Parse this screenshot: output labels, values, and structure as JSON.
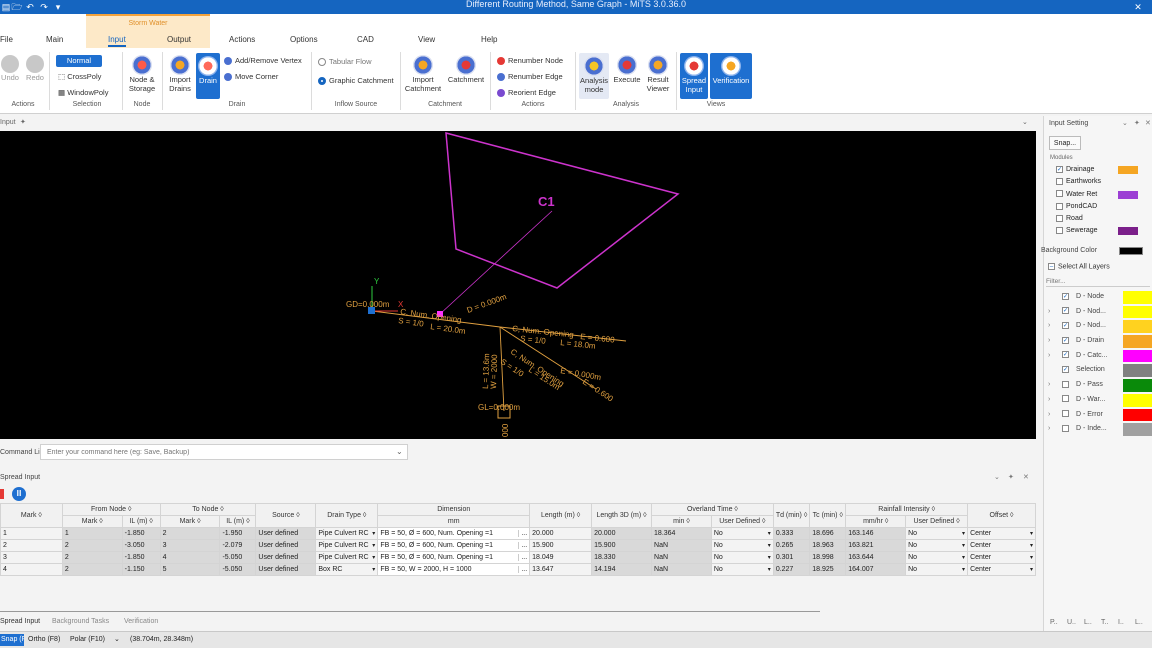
{
  "window": {
    "title": "Different Routing Method, Same Graph - MiTS 3.0.36.0"
  },
  "tabs": [
    {
      "label": "File"
    },
    {
      "label": "Main"
    },
    {
      "label": "Input"
    },
    {
      "label": "Output"
    },
    {
      "label": "Actions"
    },
    {
      "label": "Options"
    },
    {
      "label": "CAD"
    },
    {
      "label": "View"
    },
    {
      "label": "Help"
    }
  ],
  "context_tab_group": "Storm Water",
  "ribbon": {
    "actions": {
      "undo": "Undo",
      "redo": "Redo",
      "group": "Actions"
    },
    "selection": {
      "normal": "Normal",
      "crosspoly": "CrossPoly",
      "windowpoly": "WindowPoly",
      "group": "Selection"
    },
    "node": {
      "node_storage_1": "Node &",
      "node_storage_2": "Storage",
      "group": "Node"
    },
    "drain": {
      "import_1": "Import",
      "import_2": "Drains",
      "drain": "Drain",
      "add_remove_vertex": "Add/Remove Vertex",
      "move_corner": "Move Corner",
      "group": "Drain"
    },
    "inflow": {
      "tabular_flow": "Tabular Flow",
      "graphic_catchment": "Graphic Catchment",
      "group": "Inflow Source"
    },
    "catchment": {
      "import_1": "Import",
      "import_2": "Catchment",
      "catchment": "Catchment",
      "group": "Catchment"
    },
    "actions2": {
      "renumber_node": "Renumber Node",
      "renumber_edge": "Renumber Edge",
      "reorient_edge": "Reorient Edge",
      "group": "Actions"
    },
    "analysis": {
      "analysis_1": "Analysis",
      "analysis_2": "mode",
      "execute": "Execute",
      "result_1": "Result",
      "result_2": "Viewer",
      "group": "Analysis"
    },
    "views": {
      "spread_1": "Spread",
      "spread_2": "Input",
      "verification": "Verification",
      "group": "Views"
    }
  },
  "input_panel": {
    "title": "Input"
  },
  "canvas": {
    "catchment_label": "C1",
    "labels": [
      "GD=0.000m",
      "X",
      "Y",
      "C, Num. Opening",
      "S = 1/0",
      "L = 20.0m",
      "D = 0.000m",
      "C, Num. Opening",
      "E = 0.600",
      "S = 1/0",
      "L = 18.0m",
      "C, Num. Opening",
      "S = 1/0",
      "L = 15.0m",
      "E = 0.000m",
      "E = 0.600",
      "W = 2000",
      "L = 13.6m",
      "GL=0.000m",
      "000"
    ]
  },
  "command_line": {
    "label": "Command Line",
    "placeholder": "Enter your command here (eg: Save, Backup)"
  },
  "spread_input": {
    "title": "Spread Input",
    "group_headers": {
      "from_node": "From Node",
      "to_node": "To Node",
      "dimension": "Dimension",
      "overland_time": "Overland Time",
      "rainfall_intensity": "Rainfall Intensity"
    },
    "columns": {
      "mark": "Mark",
      "from_mark": "Mark",
      "from_il": "IL (m)",
      "to_mark": "Mark",
      "to_il": "IL (m)",
      "source": "Source",
      "drain_type": "Drain Type",
      "dimension_unit": "mm",
      "length": "Length (m)",
      "length3d": "Length 3D (m)",
      "ot_min": "min",
      "ot_user": "User Defined",
      "td": "Td (min)",
      "tc": "Tc (min)",
      "ri_unit": "mm/hr",
      "ri_user": "User Defined",
      "offset": "Offset"
    },
    "rows": [
      {
        "mark": "1",
        "from_mark": "1",
        "from_il": "-1.850",
        "to_mark": "2",
        "to_il": "-1.950",
        "source": "User defined",
        "drain_type": "Pipe Culvert RC",
        "dimension": "FB = 50, Ø = 600, Num. Opening =1",
        "length": "20.000",
        "length3d": "20.000",
        "ot_min": "18.364",
        "ot_user": "No",
        "td": "0.333",
        "tc": "18.696",
        "ri": "163.146",
        "ri_user": "No",
        "offset": "Center"
      },
      {
        "mark": "2",
        "from_mark": "2",
        "from_il": "-3.050",
        "to_mark": "3",
        "to_il": "-2.079",
        "source": "User defined",
        "drain_type": "Pipe Culvert RC",
        "dimension": "FB = 50, Ø = 600, Num. Opening =1",
        "length": "15.900",
        "length3d": "15.900",
        "ot_min": "NaN",
        "ot_user": "No",
        "td": "0.265",
        "tc": "18.963",
        "ri": "163.821",
        "ri_user": "No",
        "offset": "Center"
      },
      {
        "mark": "3",
        "from_mark": "2",
        "from_il": "-1.850",
        "to_mark": "4",
        "to_il": "-5.050",
        "source": "User defined",
        "drain_type": "Pipe Culvert RC",
        "dimension": "FB = 50, Ø = 600, Num. Opening =1",
        "length": "18.049",
        "length3d": "18.330",
        "ot_min": "NaN",
        "ot_user": "No",
        "td": "0.301",
        "tc": "18.998",
        "ri": "163.644",
        "ri_user": "No",
        "offset": "Center"
      },
      {
        "mark": "4",
        "from_mark": "2",
        "from_il": "-1.150",
        "to_mark": "5",
        "to_il": "-5.050",
        "source": "User defined",
        "drain_type": "Box RC",
        "dimension": "FB = 50, W = 2000, H = 1000",
        "length": "13.647",
        "length3d": "14.194",
        "ot_min": "NaN",
        "ot_user": "No",
        "td": "0.227",
        "tc": "18.925",
        "ri": "164.007",
        "ri_user": "No",
        "offset": "Center"
      }
    ]
  },
  "bottom_tabs": [
    {
      "label": "Spread Input"
    },
    {
      "label": "Background Tasks"
    },
    {
      "label": "Verification"
    }
  ],
  "status": {
    "snap": "Snap (F3)",
    "ortho": "Ortho (F8)",
    "polar": "Polar (F10)",
    "coords": "(38.704m, 28.348m)"
  },
  "input_setting": {
    "title": "Input Setting",
    "snap": "Snap...",
    "modules_label": "Modules",
    "modules": [
      {
        "label": "Drainage",
        "checked": true,
        "color": "#f5a623"
      },
      {
        "label": "Earthworks",
        "checked": false,
        "color": ""
      },
      {
        "label": "Water Ret",
        "checked": false,
        "color": "#9c3fd4"
      },
      {
        "label": "PondCAD",
        "checked": false,
        "color": ""
      },
      {
        "label": "Road",
        "checked": false,
        "color": ""
      },
      {
        "label": "Sewerage",
        "checked": false,
        "color": "#7b1f8a"
      }
    ],
    "background_color_label": "Background Color",
    "background_color": "#000000",
    "select_all_layers": "Select All Layers",
    "filter_placeholder": "Filter...",
    "layers": [
      {
        "label": "D - Node",
        "checked": true,
        "color": "#ffff00"
      },
      {
        "label": "D - Nod...",
        "checked": true,
        "color": "#ffff00"
      },
      {
        "label": "D - Nod...",
        "checked": true,
        "color": "#ffd21f"
      },
      {
        "label": "D - Drain",
        "checked": true,
        "color": "#f5a623"
      },
      {
        "label": "D - Catc...",
        "checked": true,
        "color": "#ff00ff"
      },
      {
        "label": "Selection",
        "checked": true,
        "color": "#808080"
      },
      {
        "label": "D - Pass",
        "checked": false,
        "color": "#0a8a0a"
      },
      {
        "label": "D - War...",
        "checked": false,
        "color": "#ffff00"
      },
      {
        "label": "D - Error",
        "checked": false,
        "color": "#ff0000"
      },
      {
        "label": "D - Inde...",
        "checked": false,
        "color": "#a0a0a0"
      }
    ],
    "footer_tabs": [
      "P..",
      "U..",
      "L..",
      "T..",
      "I..",
      "L.."
    ]
  }
}
